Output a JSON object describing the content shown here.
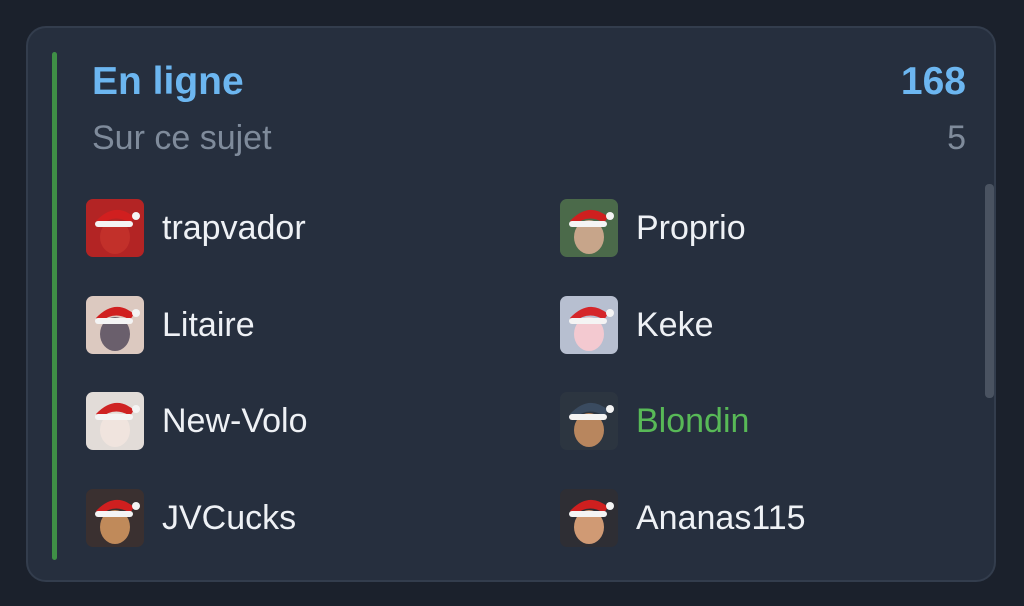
{
  "colors": {
    "accent_bar": "#3f8f46",
    "title": "#6cb6f0",
    "muted": "#7f8b9b",
    "username": "#eef1f5",
    "highlight_user": "#58b957",
    "scrollbar": "#4a5361"
  },
  "panel": {
    "title": "En ligne",
    "count": "168",
    "subtitle": "Sur ce sujet",
    "subcount": "5"
  },
  "users": [
    {
      "name": "trapvador",
      "highlighted": false,
      "avatar": "santa-hat-red-outfit",
      "bg": "#b32424",
      "face": "#c2302a",
      "hat": "#d11f1f"
    },
    {
      "name": "Proprio",
      "highlighted": false,
      "avatar": "santa-beard",
      "bg": "#4b6a4a",
      "face": "#c7a58a",
      "hat": "#cf1f1f"
    },
    {
      "name": "Litaire",
      "highlighted": false,
      "avatar": "santa-hat-cat",
      "bg": "#dcc9c0",
      "face": "#6a5f6c",
      "hat": "#d02020"
    },
    {
      "name": "Keke",
      "highlighted": false,
      "avatar": "santa-hat-anime-girl",
      "bg": "#b7bfd0",
      "face": "#f3c9d0",
      "hat": "#d5262a"
    },
    {
      "name": "New-Volo",
      "highlighted": false,
      "avatar": "santa-hat-dark-hair-girl",
      "bg": "#e2dcd8",
      "face": "#f0e4de",
      "hat": "#cf2323"
    },
    {
      "name": "Blondin",
      "highlighted": true,
      "avatar": "western-portrait",
      "bg": "#2c3540",
      "face": "#b8865e",
      "hat": "#3a4b60"
    },
    {
      "name": "JVCucks",
      "highlighted": false,
      "avatar": "santa-hat-dog",
      "bg": "#3a3030",
      "face": "#c08a5a",
      "hat": "#cf1f1f"
    },
    {
      "name": "Ananas115",
      "highlighted": false,
      "avatar": "santa-hat-man-suit",
      "bg": "#2e2e34",
      "face": "#d09a74",
      "hat": "#cf1f1f"
    }
  ]
}
